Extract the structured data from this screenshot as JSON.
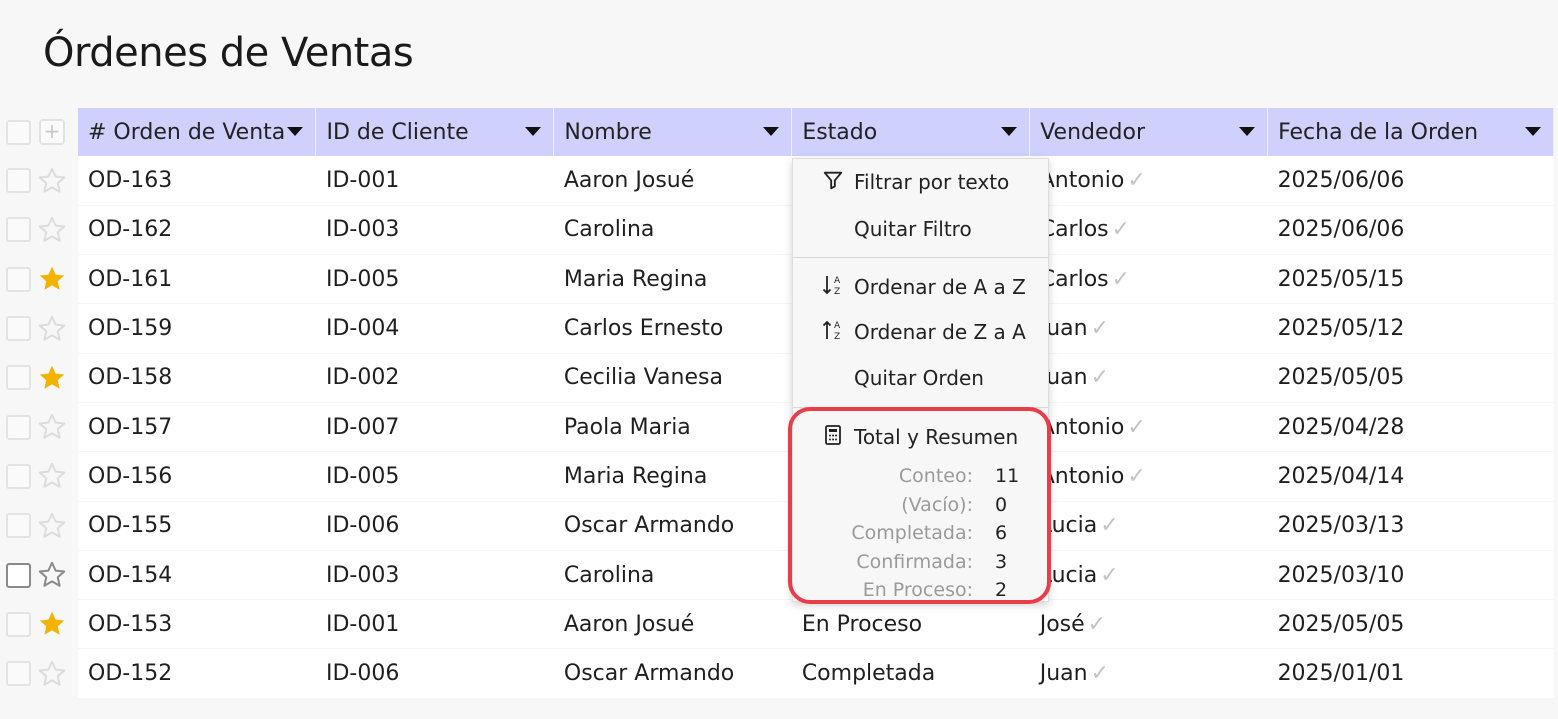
{
  "page": {
    "title": "Órdenes de Ventas"
  },
  "columns": [
    {
      "label": "# Orden de Venta"
    },
    {
      "label": "ID de Cliente"
    },
    {
      "label": "Nombre"
    },
    {
      "label": "Estado"
    },
    {
      "label": "Vendedor"
    },
    {
      "label": "Fecha de la Orden"
    }
  ],
  "rows": [
    {
      "orden": "OD-163",
      "cliente": "ID-001",
      "nombre": "Aaron Josué",
      "estado": "",
      "vendedor": "Antonio",
      "fecha": "2025/06/06",
      "starred": false
    },
    {
      "orden": "OD-162",
      "cliente": "ID-003",
      "nombre": "Carolina",
      "estado": "",
      "vendedor": "Carlos",
      "fecha": "2025/06/06",
      "starred": false
    },
    {
      "orden": "OD-161",
      "cliente": "ID-005",
      "nombre": "Maria Regina",
      "estado": "",
      "vendedor": "Carlos",
      "fecha": "2025/05/15",
      "starred": true
    },
    {
      "orden": "OD-159",
      "cliente": "ID-004",
      "nombre": "Carlos Ernesto",
      "estado": "",
      "vendedor": "Juan",
      "fecha": "2025/05/12",
      "starred": false
    },
    {
      "orden": "OD-158",
      "cliente": "ID-002",
      "nombre": "Cecilia Vanesa",
      "estado": "",
      "vendedor": "Juan",
      "fecha": "2025/05/05",
      "starred": true
    },
    {
      "orden": "OD-157",
      "cliente": "ID-007",
      "nombre": "Paola Maria",
      "estado": "",
      "vendedor": "Antonio",
      "fecha": "2025/04/28",
      "starred": false
    },
    {
      "orden": "OD-156",
      "cliente": "ID-005",
      "nombre": "Maria Regina",
      "estado": "",
      "vendedor": "Antonio",
      "fecha": "2025/04/14",
      "starred": false
    },
    {
      "orden": "OD-155",
      "cliente": "ID-006",
      "nombre": "Oscar Armando",
      "estado": "",
      "vendedor": "Lucia",
      "fecha": "2025/03/13",
      "starred": false
    },
    {
      "orden": "OD-154",
      "cliente": "ID-003",
      "nombre": "Carolina",
      "estado": "",
      "vendedor": "Lucia",
      "fecha": "2025/03/10",
      "starred": false
    },
    {
      "orden": "OD-153",
      "cliente": "ID-001",
      "nombre": "Aaron Josué",
      "estado": "En Proceso",
      "vendedor": "José",
      "fecha": "2025/05/05",
      "starred": true
    },
    {
      "orden": "OD-152",
      "cliente": "ID-006",
      "nombre": "Oscar Armando",
      "estado": "Completada",
      "vendedor": "Juan",
      "fecha": "2025/01/01",
      "starred": false
    }
  ],
  "menu": {
    "filter_text": "Filtrar por texto",
    "remove_filter": "Quitar Filtro",
    "sort_az": "Ordenar de A a Z",
    "sort_za": "Ordenar de Z a A",
    "remove_sort": "Quitar Orden",
    "summary_title": "Total y Resumen",
    "summary": [
      {
        "label": "Conteo:",
        "value": "11"
      },
      {
        "label": "(Vacío):",
        "value": "0"
      },
      {
        "label": "Completada:",
        "value": "6"
      },
      {
        "label": "Confirmada:",
        "value": "3"
      },
      {
        "label": "En Proceso:",
        "value": "2"
      }
    ]
  },
  "colors": {
    "header_bg": "#cfd0fc",
    "link": "#1b7fd1",
    "star_on": "#f5b301",
    "highlight": "#e93d48"
  },
  "icons": {
    "filter": "funnel-icon",
    "sort_az": "sort-ascending-icon",
    "sort_za": "sort-descending-icon",
    "summary": "calculator-icon",
    "row_star": "star-icon",
    "add": "plus-icon"
  }
}
